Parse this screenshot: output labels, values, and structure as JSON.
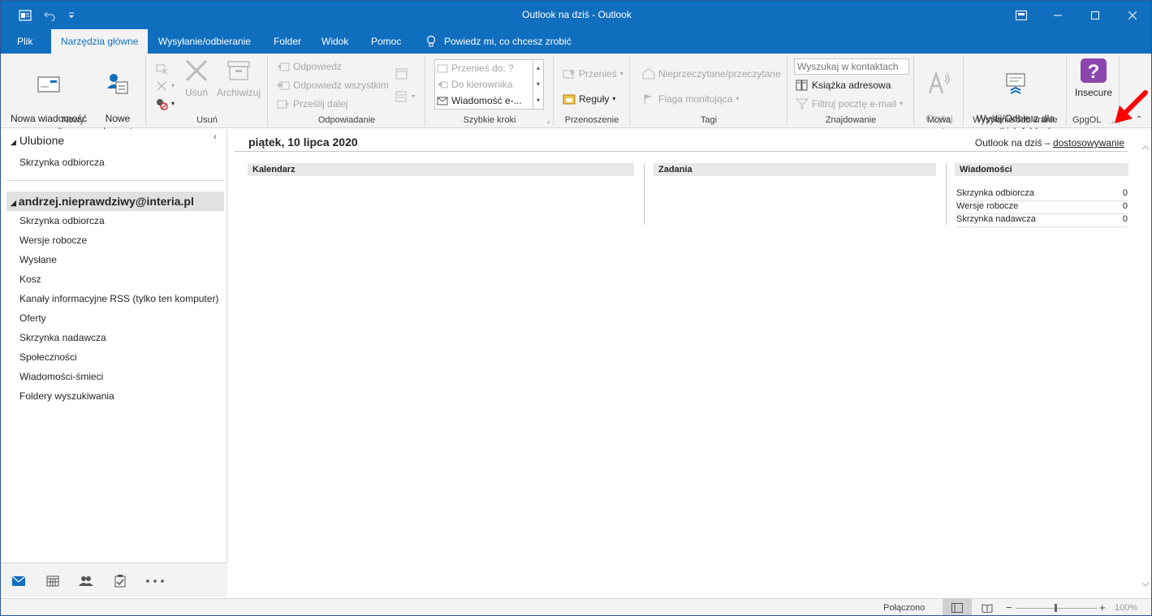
{
  "window": {
    "title": "Outlook na dziś  -  Outlook"
  },
  "tabs": [
    {
      "label": "Plik"
    },
    {
      "label": "Narzędzia główne"
    },
    {
      "label": "Wysyłanie/odbieranie"
    },
    {
      "label": "Folder"
    },
    {
      "label": "Widok"
    },
    {
      "label": "Pomoc"
    }
  ],
  "tellme": "Powiedz mi, co chcesz zrobić",
  "ribbon": {
    "nowy": {
      "label": "Nowy",
      "new_email": "Nowa wiadomość\ne-mail",
      "new_items": "Nowe\nelementy"
    },
    "usun": {
      "label": "Usuń",
      "delete": "Usuń",
      "archive": "Archiwizuj"
    },
    "odpowiadanie": {
      "label": "Odpowiadanie",
      "reply": "Odpowiedz",
      "reply_all": "Odpowiedz wszystkim",
      "forward": "Prześlij dalej"
    },
    "szybkie": {
      "label": "Szybkie kroki",
      "items": [
        "Przenieś do: ?",
        "Do kierownika",
        "Wiadomość e-..."
      ]
    },
    "przenoszenie": {
      "label": "Przenoszenie",
      "move": "Przenieś",
      "rules": "Reguły"
    },
    "tagi": {
      "label": "Tagi",
      "unread": "Nieprzeczytane/przeczytane",
      "flag": "Flaga monitująca"
    },
    "znajdowanie": {
      "label": "Znajdowanie",
      "search_placeholder": "Wyszukaj w kontaktach",
      "addressbook": "Książka adresowa",
      "filter": "Filtruj pocztę e-mail"
    },
    "mowa": {
      "label": "Mowa",
      "read_aloud": "Czytaj\nna głos"
    },
    "wysylanie": {
      "label": "Wysyłanie/odbieranie",
      "send_all": "Wyślij/Odbierz dla\nwszystkich folderów"
    },
    "gpgol": {
      "label": "GpgOL",
      "insecure": "Insecure"
    }
  },
  "nav": {
    "favorites_header": "Ulubione",
    "favorites": [
      "Skrzynka odbiorcza"
    ],
    "account": "andrzej.nieprawdziwy@interia.pl",
    "folders": [
      "Skrzynka odbiorcza",
      "Wersje robocze",
      "Wysłane",
      "Kosz",
      "Kanały informacyjne RSS (tylko ten komputer)",
      "Oferty",
      "Skrzynka nadawcza",
      "Społeczności",
      "Wiadomości-śmieci",
      "Foldery wyszukiwania"
    ]
  },
  "main": {
    "date": "piątek, 10 lipca 2020",
    "customize_prefix": "Outlook na dziś – ",
    "customize_link": "dostosowywanie",
    "calendar_header": "Kalendarz",
    "tasks_header": "Zadania",
    "messages_header": "Wiadomości",
    "messages": [
      {
        "name": "Skrzynka odbiorcza",
        "count": "0"
      },
      {
        "name": "Wersje robocze",
        "count": "0"
      },
      {
        "name": "Skrzynka nadawcza",
        "count": "0"
      }
    ]
  },
  "status": {
    "connection": "Połączono",
    "zoom": "100%"
  },
  "colors": {
    "brand": "#106ebe",
    "ribbon_bg": "#f3f3f3",
    "gpgol_purple": "#8e44ad",
    "arrow_red": "#ff0000"
  }
}
